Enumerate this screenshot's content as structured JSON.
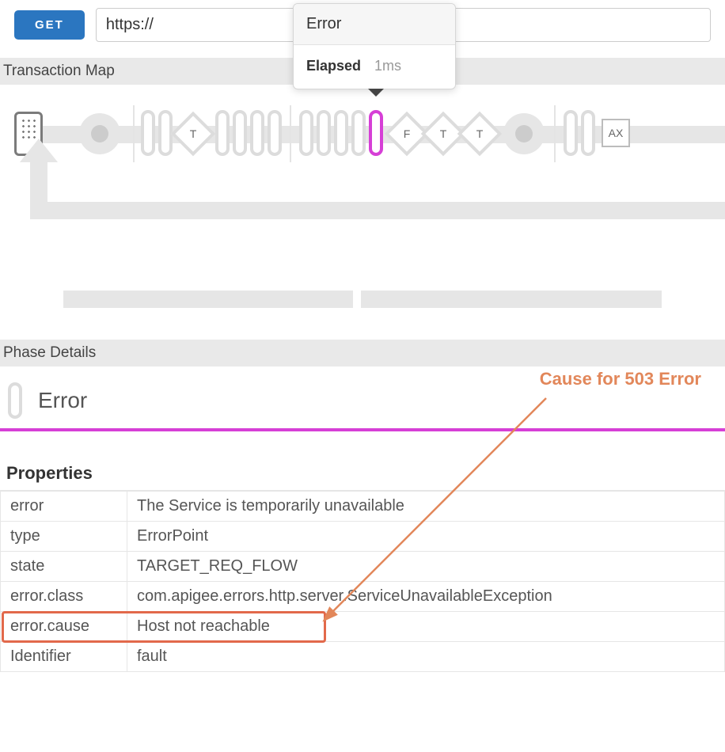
{
  "topbar": {
    "method_label": "GET",
    "url_value": "https://"
  },
  "popover": {
    "title": "Error",
    "elapsed_label": "Elapsed",
    "elapsed_value": "1ms"
  },
  "sections": {
    "transaction_map": "Transaction Map",
    "phase_details": "Phase Details"
  },
  "tmap": {
    "labels": {
      "T": "T",
      "F": "F",
      "AX": "AX"
    }
  },
  "phase": {
    "title": "Error",
    "annotation": "Cause for 503 Error"
  },
  "properties": {
    "heading": "Properties",
    "rows": [
      {
        "k": "error",
        "v": "The Service is temporarily unavailable"
      },
      {
        "k": "type",
        "v": "ErrorPoint"
      },
      {
        "k": "state",
        "v": "TARGET_REQ_FLOW"
      },
      {
        "k": "error.class",
        "v": "com.apigee.errors.http.server.ServiceUnavailableException"
      },
      {
        "k": "error.cause",
        "v": "Host not reachable",
        "highlight": true
      },
      {
        "k": "Identifier",
        "v": "fault"
      }
    ]
  }
}
